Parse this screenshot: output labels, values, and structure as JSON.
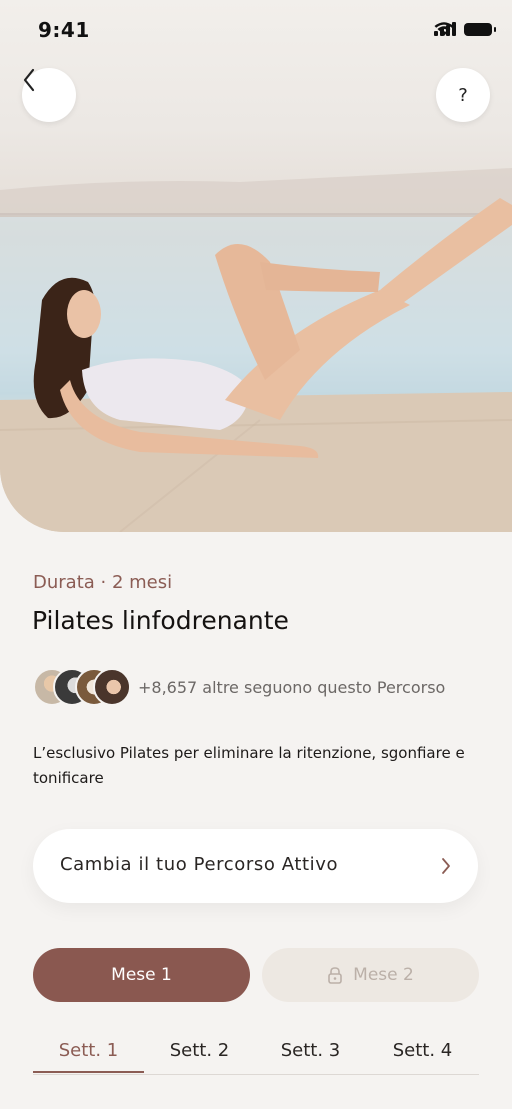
{
  "status_bar": {
    "time": "9:41"
  },
  "header": {
    "help_label": "?"
  },
  "program": {
    "duration": "Durata · 2 mesi",
    "title": "Pilates linfodrenante",
    "followers_text": "+8,657 altre seguono questo Percorso",
    "description": "L’esclusivo Pilates per eliminare la ritenzione, sgonfiare e tonificare"
  },
  "change_path": {
    "label": "Cambia il tuo Percorso Attivo"
  },
  "months": [
    {
      "label": "Mese 1",
      "active": true,
      "locked": false
    },
    {
      "label": "Mese 2",
      "active": false,
      "locked": true
    }
  ],
  "weeks": [
    {
      "label": "Sett. 1",
      "active": true
    },
    {
      "label": "Sett. 2",
      "active": false
    },
    {
      "label": "Sett. 3",
      "active": false
    },
    {
      "label": "Sett. 4",
      "active": false
    }
  ],
  "colors": {
    "accent": "#8a5850",
    "accent_text": "#8b5c54",
    "background": "#f5f3f1",
    "locked_bg": "#ede8e2"
  }
}
